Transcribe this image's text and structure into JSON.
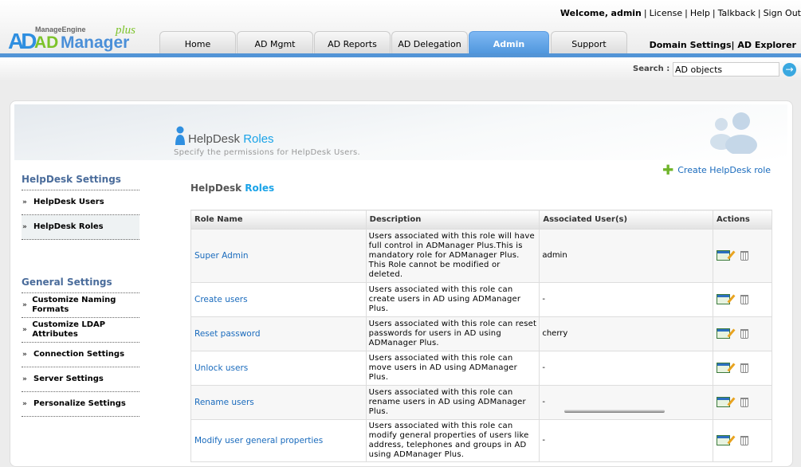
{
  "header": {
    "welcome": "Welcome,",
    "user": "admin",
    "links": [
      "License",
      "Help",
      "Talkback",
      "Sign Out"
    ]
  },
  "logo": {
    "vendor": "ManageEngine",
    "a": "AD",
    "ad": "AD",
    "manager": "Manager",
    "plus": "plus"
  },
  "tabs": [
    "Home",
    "AD Mgmt",
    "AD Reports",
    "AD Delegation",
    "Admin",
    "Support"
  ],
  "active_tab": "Admin",
  "right_links": {
    "domain": "Domain Settings",
    "explorer": "AD Explorer"
  },
  "search": {
    "label": "Search :",
    "value": "AD objects"
  },
  "page": {
    "title_a": "HelpDesk",
    "title_b": " Roles",
    "subtitle": "Specify the permissions for HelpDesk Users.",
    "section_a": "HelpDesk",
    "section_b": " Roles",
    "create": "Create HelpDesk role"
  },
  "sidebar": {
    "helpdesk_title": "HelpDesk Settings",
    "helpdesk_items": [
      "HelpDesk Users",
      "HelpDesk Roles"
    ],
    "general_title": "General Settings",
    "general_items": [
      "Customize Naming Formats",
      "Customize LDAP Attributes",
      "Connection Settings",
      "Server Settings",
      "Personalize Settings"
    ]
  },
  "table": {
    "headers": [
      "Role Name",
      "Description",
      "Associated User(s)",
      "Actions"
    ],
    "rows": [
      {
        "name": "Super Admin",
        "desc": "Users associated with this role will have full control in ADManager Plus.This is mandatory role for ADManager Plus. This Role cannot be modified or deleted.",
        "users": "admin"
      },
      {
        "name": "Create users",
        "desc": "Users associated with this role can create users in AD using ADManager Plus.",
        "users": "-"
      },
      {
        "name": "Reset password",
        "desc": "Users associated with this role can reset passwords for users in AD using ADManager Plus.",
        "users": "cherry"
      },
      {
        "name": "Unlock users",
        "desc": "Users associated with this role can move users in AD using ADManager Plus.",
        "users": "-"
      },
      {
        "name": "Rename users",
        "desc": "Users associated with this role can rename users in AD using ADManager Plus.",
        "users": "-"
      },
      {
        "name": "Modify user general properties",
        "desc": "Users associated with this role can modify general properties of users like address, telephones and groups in AD using ADManager Plus.",
        "users": "-"
      }
    ]
  }
}
